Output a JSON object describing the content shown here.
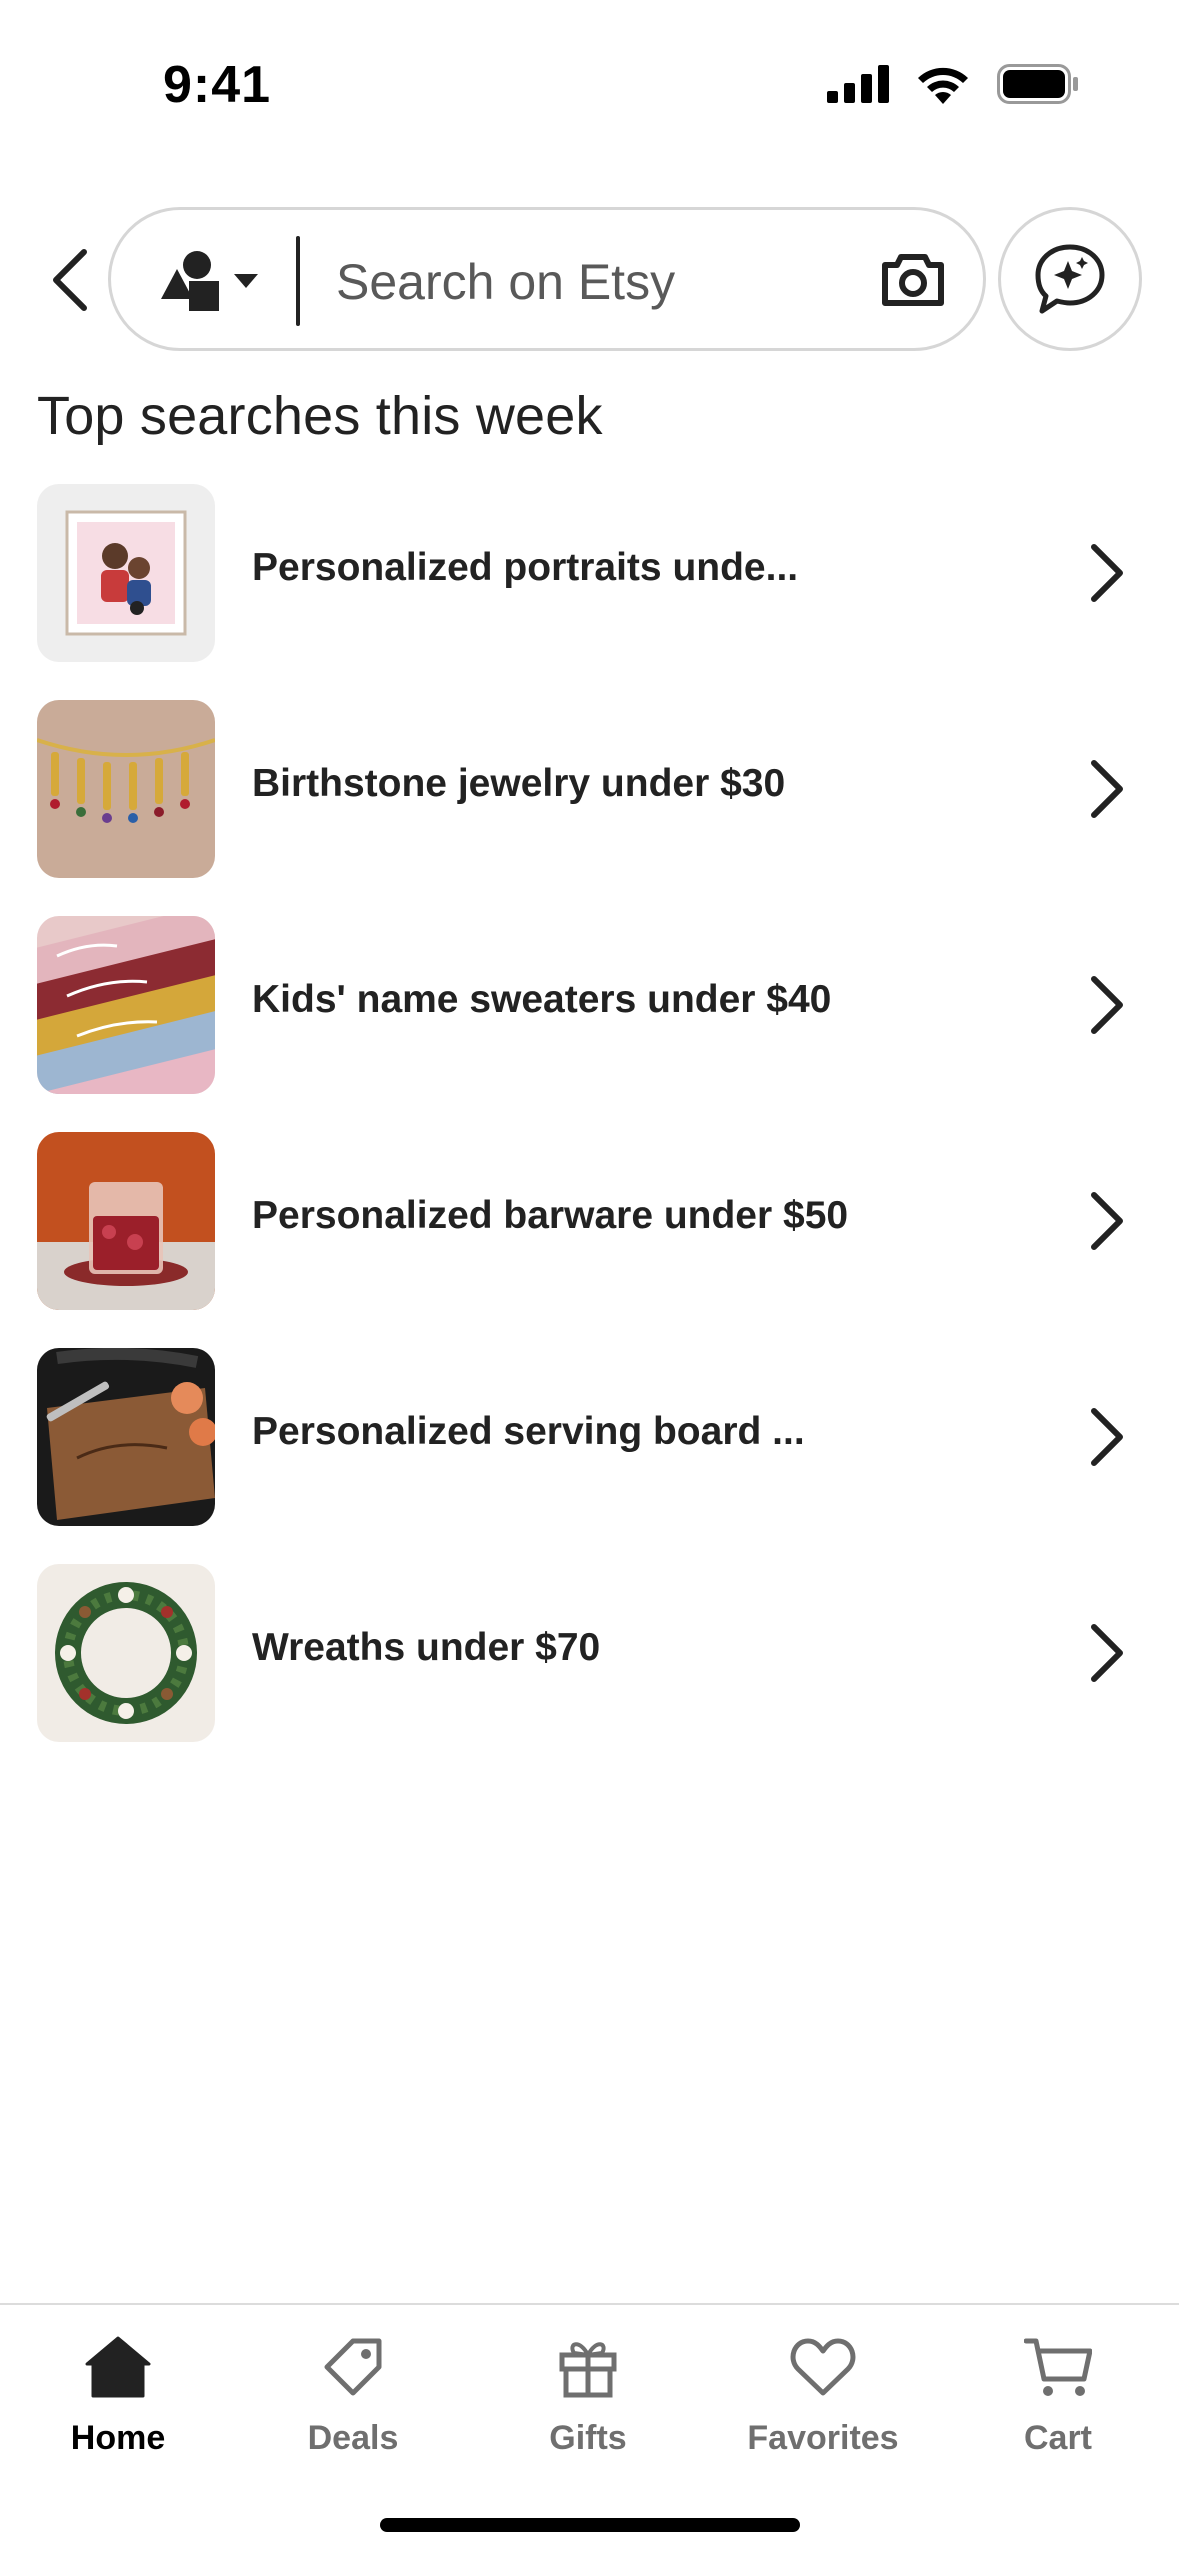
{
  "status_bar": {
    "time": "9:41",
    "icons": [
      "cellular-signal-icon",
      "wifi-icon",
      "battery-icon"
    ]
  },
  "search": {
    "placeholder": "Search on Etsy",
    "value": "",
    "icons": {
      "back": "chevron-left-icon",
      "category": "shapes-icon",
      "category_dropdown": "caret-down-icon",
      "camera": "camera-icon",
      "ai_chat": "sparkle-chat-icon"
    }
  },
  "section": {
    "title": "Top searches this week"
  },
  "top_searches": [
    {
      "label": "Personalized portraits unde...",
      "thumb": "portrait-thumbnail"
    },
    {
      "label": "Birthstone jewelry under $30",
      "thumb": "jewelry-thumbnail"
    },
    {
      "label": "Kids' name sweaters under $40",
      "thumb": "sweaters-thumbnail"
    },
    {
      "label": "Personalized barware under $50",
      "thumb": "barware-thumbnail"
    },
    {
      "label": "Personalized serving board ...",
      "thumb": "serving-board-thumbnail"
    },
    {
      "label": "Wreaths under $70",
      "thumb": "wreath-thumbnail"
    }
  ],
  "bottom_nav": {
    "active": "Home",
    "items": [
      {
        "label": "Home",
        "icon": "home-icon"
      },
      {
        "label": "Deals",
        "icon": "tag-icon"
      },
      {
        "label": "Gifts",
        "icon": "gift-icon"
      },
      {
        "label": "Favorites",
        "icon": "heart-icon"
      },
      {
        "label": "Cart",
        "icon": "cart-icon"
      }
    ]
  },
  "colors": {
    "text": "#222222",
    "placeholder": "#595959",
    "border": "#d6d6d6",
    "nav_inactive": "#6f6f6f",
    "nav_active": "#000000"
  }
}
